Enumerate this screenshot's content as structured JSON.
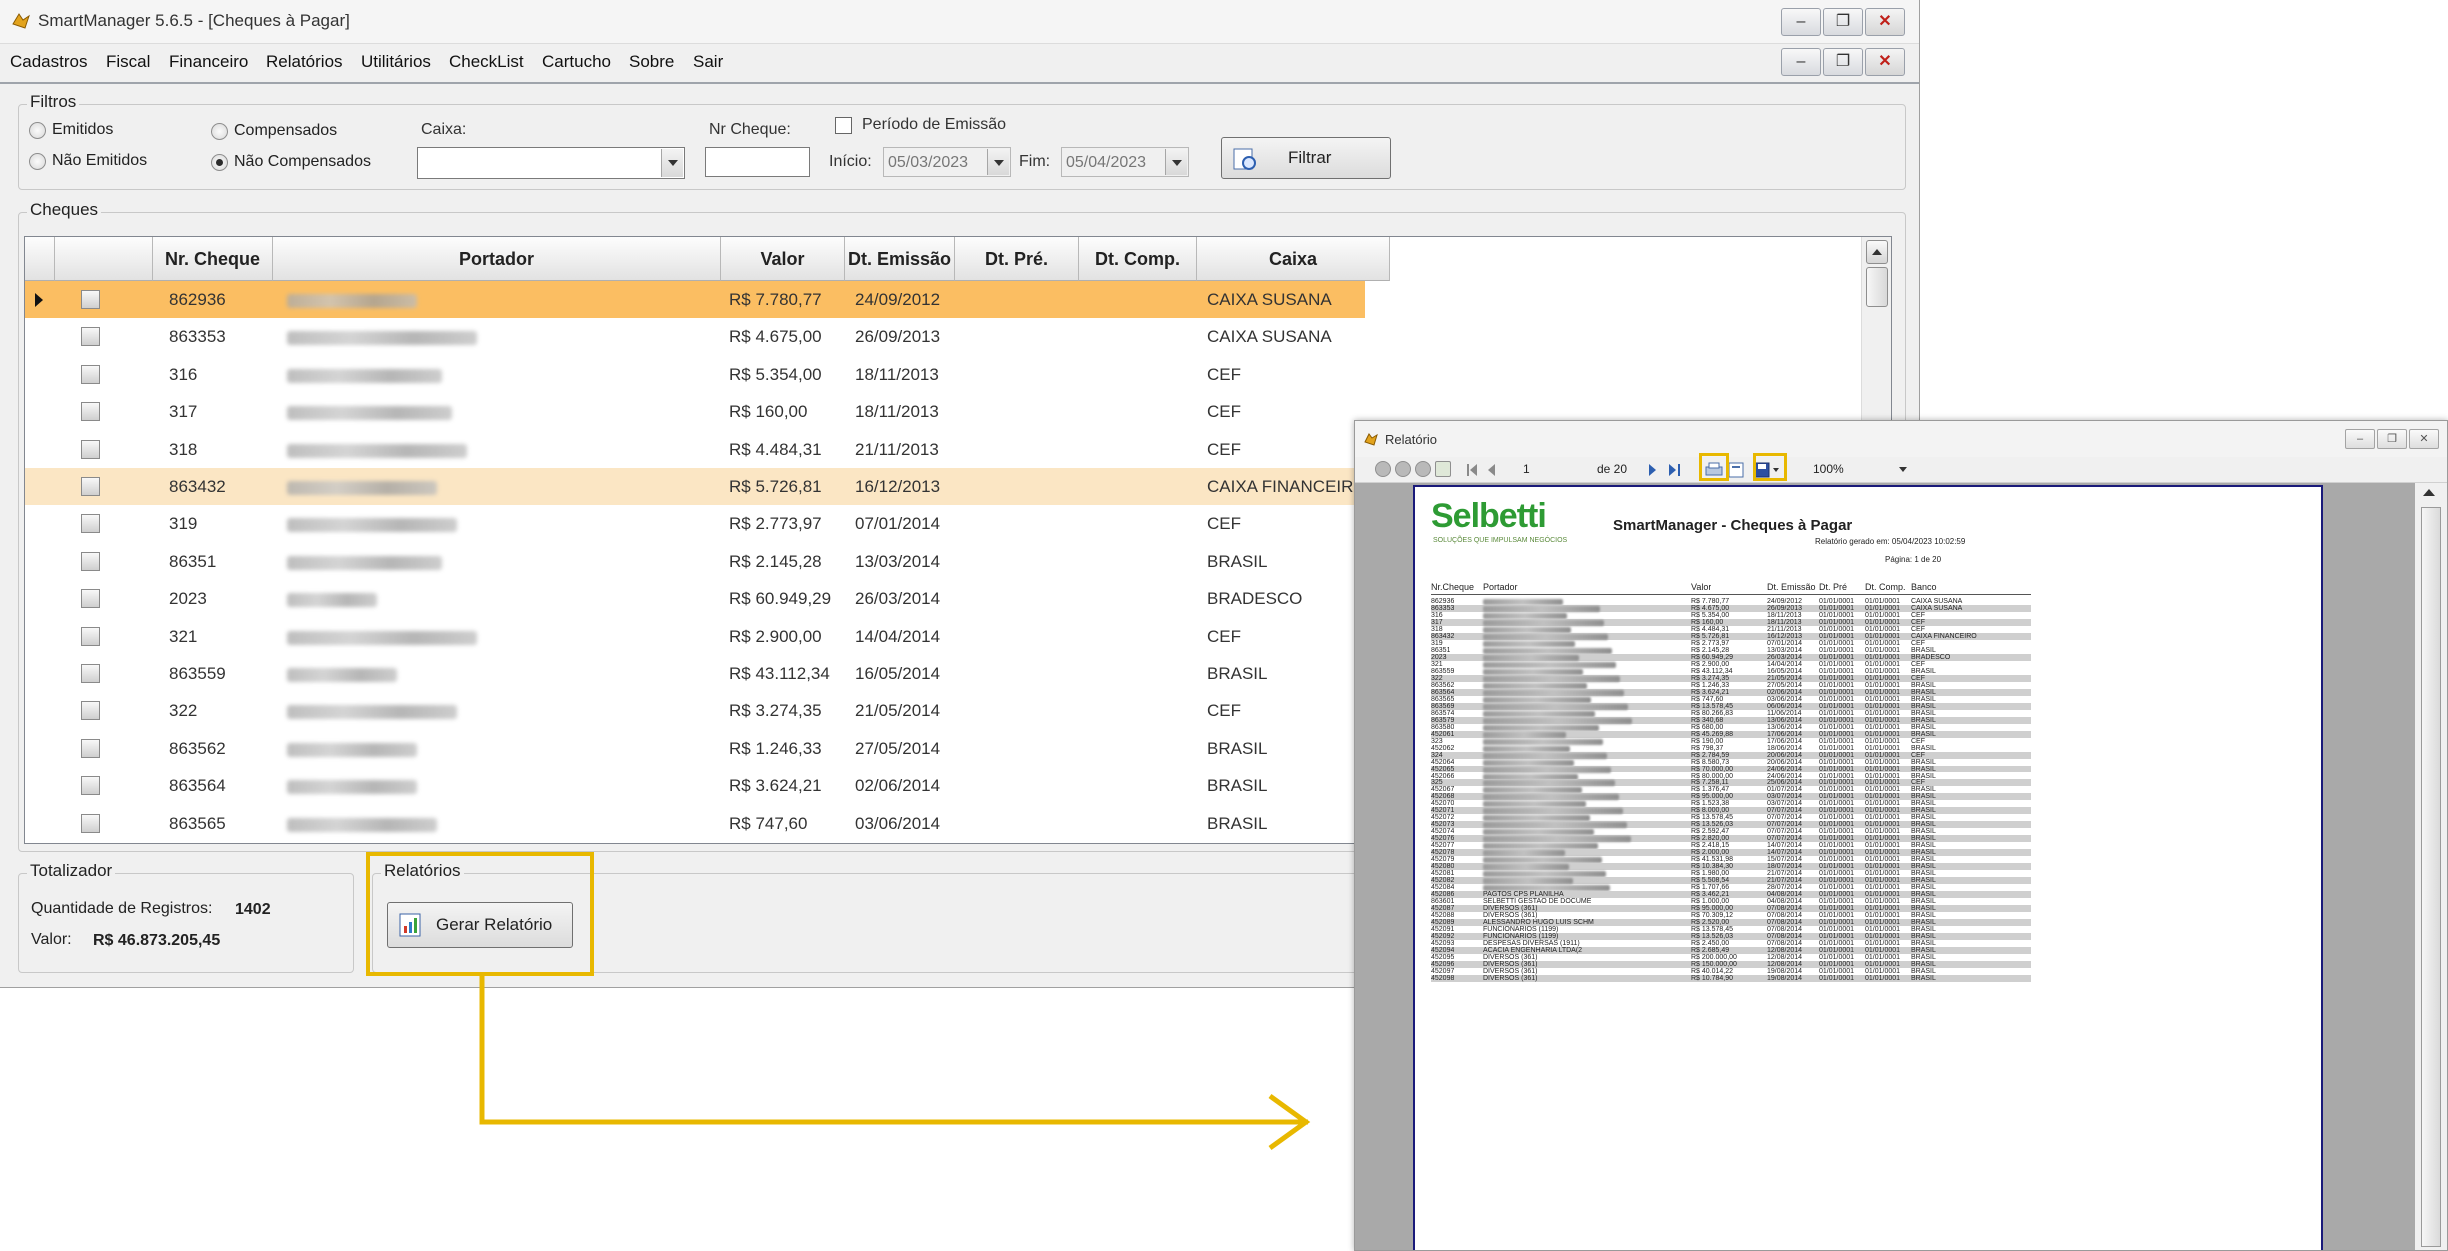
{
  "main_window": {
    "title": "SmartManager 5.6.5 - [Cheques à Pagar]",
    "window_buttons": {
      "minimize": "–",
      "restore": "❐",
      "close": "✕"
    },
    "menu": [
      "Cadastros",
      "Fiscal",
      "Financeiro",
      "Relatórios",
      "Utilitários",
      "CheckList",
      "Cartucho",
      "Sobre",
      "Sair"
    ]
  },
  "filters": {
    "legend": "Filtros",
    "radio_emitidos": "Emitidos",
    "radio_nao_emitidos": "Não Emitidos",
    "radio_compensados": "Compensados",
    "radio_nao_compensados": "Não Compensados",
    "selected_radio": "Não Compensados",
    "caixa_label": "Caixa:",
    "caixa_value": "",
    "nr_cheque_label": "Nr Cheque:",
    "nr_cheque_value": "",
    "periodo_label": "Período de Emissão",
    "periodo_checked": false,
    "inicio_label": "Início:",
    "inicio_value": "05/03/2023",
    "fim_label": "Fim:",
    "fim_value": "05/04/2023",
    "filtrar_button": "Filtrar"
  },
  "cheques": {
    "legend": "Cheques",
    "columns": [
      "Nr. Cheque",
      "Portador",
      "Valor",
      "Dt. Emissão",
      "Dt. Pré.",
      "Dt. Comp.",
      "Caixa"
    ],
    "rows": [
      {
        "nr": "862936",
        "valor": "R$ 7.780,77",
        "emissao": "24/09/2012",
        "caixa": "CAIXA SUSANA",
        "state": "selected"
      },
      {
        "nr": "863353",
        "valor": "R$ 4.675,00",
        "emissao": "26/09/2013",
        "caixa": "CAIXA SUSANA",
        "state": ""
      },
      {
        "nr": "316",
        "valor": "R$ 5.354,00",
        "emissao": "18/11/2013",
        "caixa": "CEF",
        "state": ""
      },
      {
        "nr": "317",
        "valor": "R$ 160,00",
        "emissao": "18/11/2013",
        "caixa": "CEF",
        "state": ""
      },
      {
        "nr": "318",
        "valor": "R$ 4.484,31",
        "emissao": "21/11/2013",
        "caixa": "CEF",
        "state": ""
      },
      {
        "nr": "863432",
        "valor": "R$ 5.726,81",
        "emissao": "16/12/2013",
        "caixa": "CAIXA FINANCEIRO",
        "state": "alt"
      },
      {
        "nr": "319",
        "valor": "R$ 2.773,97",
        "emissao": "07/01/2014",
        "caixa": "CEF",
        "state": ""
      },
      {
        "nr": "86351",
        "valor": "R$ 2.145,28",
        "emissao": "13/03/2014",
        "caixa": "BRASIL",
        "state": ""
      },
      {
        "nr": "2023",
        "valor": "R$ 60.949,29",
        "emissao": "26/03/2014",
        "caixa": "BRADESCO",
        "state": ""
      },
      {
        "nr": "321",
        "valor": "R$ 2.900,00",
        "emissao": "14/04/2014",
        "caixa": "CEF",
        "state": ""
      },
      {
        "nr": "863559",
        "valor": "R$ 43.112,34",
        "emissao": "16/05/2014",
        "caixa": "BRASIL",
        "state": ""
      },
      {
        "nr": "322",
        "valor": "R$ 3.274,35",
        "emissao": "21/05/2014",
        "caixa": "CEF",
        "state": ""
      },
      {
        "nr": "863562",
        "valor": "R$ 1.246,33",
        "emissao": "27/05/2014",
        "caixa": "BRASIL",
        "state": ""
      },
      {
        "nr": "863564",
        "valor": "R$ 3.624,21",
        "emissao": "02/06/2014",
        "caixa": "BRASIL",
        "state": ""
      },
      {
        "nr": "863565",
        "valor": "R$ 747,60",
        "emissao": "03/06/2014",
        "caixa": "BRASIL",
        "state": ""
      }
    ]
  },
  "totalizador": {
    "legend": "Totalizador",
    "quantidade_label": "Quantidade de Registros:",
    "quantidade_value": "1402",
    "valor_label": "Valor:",
    "valor_value": "R$ 46.873.205,45"
  },
  "relatorios": {
    "legend": "Relatórios",
    "gerar_button": "Gerar Relatório"
  },
  "highlight_color": "#e8b800",
  "report_window": {
    "title": "Relatório",
    "toolbar": {
      "page": "1",
      "of_pages": "de 20",
      "zoom": "100%"
    },
    "logo": "Selbetti",
    "logo_tagline": "SOLUÇÕES QUE IMPULSAM NEGÓCIOS",
    "report_title": "SmartManager - Cheques à Pagar",
    "generated": "Relatório gerado em: 05/04/2023 10:02:59",
    "page_label": "Página: 1 de 20",
    "columns": [
      "Nr.Cheque",
      "Portador",
      "Valor",
      "Dt. Emissão",
      "Dt. Pré",
      "Dt. Comp.",
      "Banco"
    ],
    "rows": [
      {
        "nr": "862936",
        "portador": "",
        "valor": "R$ 7.780,77",
        "emissao": "24/09/2012",
        "pre": "01/01/0001",
        "comp": "01/01/0001",
        "banco": "CAIXA SUSANA"
      },
      {
        "nr": "863353",
        "portador": "",
        "valor": "R$ 4.675,00",
        "emissao": "26/09/2013",
        "pre": "01/01/0001",
        "comp": "01/01/0001",
        "banco": "CAIXA SUSANA"
      },
      {
        "nr": "316",
        "portador": "",
        "valor": "R$ 5.354,00",
        "emissao": "18/11/2013",
        "pre": "01/01/0001",
        "comp": "01/01/0001",
        "banco": "CEF"
      },
      {
        "nr": "317",
        "portador": "",
        "valor": "R$ 160,00",
        "emissao": "18/11/2013",
        "pre": "01/01/0001",
        "comp": "01/01/0001",
        "banco": "CEF"
      },
      {
        "nr": "318",
        "portador": "",
        "valor": "R$ 4.484,31",
        "emissao": "21/11/2013",
        "pre": "01/01/0001",
        "comp": "01/01/0001",
        "banco": "CEF"
      },
      {
        "nr": "863432",
        "portador": "",
        "valor": "R$ 5.726,81",
        "emissao": "16/12/2013",
        "pre": "01/01/0001",
        "comp": "01/01/0001",
        "banco": "CAIXA FINANCEIRO"
      },
      {
        "nr": "319",
        "portador": "",
        "valor": "R$ 2.773,97",
        "emissao": "07/01/2014",
        "pre": "01/01/0001",
        "comp": "01/01/0001",
        "banco": "CEF"
      },
      {
        "nr": "86351",
        "portador": "",
        "valor": "R$ 2.145,28",
        "emissao": "13/03/2014",
        "pre": "01/01/0001",
        "comp": "01/01/0001",
        "banco": "BRASIL"
      },
      {
        "nr": "2023",
        "portador": "",
        "valor": "R$ 60.949,29",
        "emissao": "26/03/2014",
        "pre": "01/01/0001",
        "comp": "01/01/0001",
        "banco": "BRADESCO"
      },
      {
        "nr": "321",
        "portador": "",
        "valor": "R$ 2.900,00",
        "emissao": "14/04/2014",
        "pre": "01/01/0001",
        "comp": "01/01/0001",
        "banco": "CEF"
      },
      {
        "nr": "863559",
        "portador": "",
        "valor": "R$ 43.112,34",
        "emissao": "16/05/2014",
        "pre": "01/01/0001",
        "comp": "01/01/0001",
        "banco": "BRASIL"
      },
      {
        "nr": "322",
        "portador": "",
        "valor": "R$ 3.274,35",
        "emissao": "21/05/2014",
        "pre": "01/01/0001",
        "comp": "01/01/0001",
        "banco": "CEF"
      },
      {
        "nr": "863562",
        "portador": "",
        "valor": "R$ 1.246,33",
        "emissao": "27/05/2014",
        "pre": "01/01/0001",
        "comp": "01/01/0001",
        "banco": "BRASIL"
      },
      {
        "nr": "863564",
        "portador": "",
        "valor": "R$ 3.624,21",
        "emissao": "02/06/2014",
        "pre": "01/01/0001",
        "comp": "01/01/0001",
        "banco": "BRASIL"
      },
      {
        "nr": "863565",
        "portador": "",
        "valor": "R$ 747,60",
        "emissao": "03/06/2014",
        "pre": "01/01/0001",
        "comp": "01/01/0001",
        "banco": "BRASIL"
      },
      {
        "nr": "863569",
        "portador": "",
        "valor": "R$ 13.578,45",
        "emissao": "06/06/2014",
        "pre": "01/01/0001",
        "comp": "01/01/0001",
        "banco": "BRASIL"
      },
      {
        "nr": "863574",
        "portador": "",
        "valor": "R$ 80.266,83",
        "emissao": "11/06/2014",
        "pre": "01/01/0001",
        "comp": "01/01/0001",
        "banco": "BRASIL"
      },
      {
        "nr": "863579",
        "portador": "",
        "valor": "R$ 340,68",
        "emissao": "13/06/2014",
        "pre": "01/01/0001",
        "comp": "01/01/0001",
        "banco": "BRASIL"
      },
      {
        "nr": "863580",
        "portador": "",
        "valor": "R$ 680,00",
        "emissao": "13/06/2014",
        "pre": "01/01/0001",
        "comp": "01/01/0001",
        "banco": "BRASIL"
      },
      {
        "nr": "452061",
        "portador": "",
        "valor": "R$ 45.269,88",
        "emissao": "17/06/2014",
        "pre": "01/01/0001",
        "comp": "01/01/0001",
        "banco": "BRASIL"
      },
      {
        "nr": "323",
        "portador": "",
        "valor": "R$ 190,00",
        "emissao": "17/06/2014",
        "pre": "01/01/0001",
        "comp": "01/01/0001",
        "banco": "CEF"
      },
      {
        "nr": "452062",
        "portador": "",
        "valor": "R$ 798,37",
        "emissao": "18/06/2014",
        "pre": "01/01/0001",
        "comp": "01/01/0001",
        "banco": "BRASIL"
      },
      {
        "nr": "324",
        "portador": "",
        "valor": "R$ 2.784,59",
        "emissao": "20/06/2014",
        "pre": "01/01/0001",
        "comp": "01/01/0001",
        "banco": "CEF"
      },
      {
        "nr": "452064",
        "portador": "",
        "valor": "R$ 8.580,73",
        "emissao": "20/06/2014",
        "pre": "01/01/0001",
        "comp": "01/01/0001",
        "banco": "BRASIL"
      },
      {
        "nr": "452065",
        "portador": "",
        "valor": "R$ 70.000,00",
        "emissao": "24/06/2014",
        "pre": "01/01/0001",
        "comp": "01/01/0001",
        "banco": "BRASIL"
      },
      {
        "nr": "452066",
        "portador": "",
        "valor": "R$ 80.000,00",
        "emissao": "24/06/2014",
        "pre": "01/01/0001",
        "comp": "01/01/0001",
        "banco": "BRASIL"
      },
      {
        "nr": "325",
        "portador": "",
        "valor": "R$ 7.258,11",
        "emissao": "25/06/2014",
        "pre": "01/01/0001",
        "comp": "01/01/0001",
        "banco": "CEF"
      },
      {
        "nr": "452067",
        "portador": "",
        "valor": "R$ 1.376,47",
        "emissao": "01/07/2014",
        "pre": "01/01/0001",
        "comp": "01/01/0001",
        "banco": "BRASIL"
      },
      {
        "nr": "452068",
        "portador": "",
        "valor": "R$ 95.000,00",
        "emissao": "03/07/2014",
        "pre": "01/01/0001",
        "comp": "01/01/0001",
        "banco": "BRASIL"
      },
      {
        "nr": "452070",
        "portador": "",
        "valor": "R$ 1.523,38",
        "emissao": "03/07/2014",
        "pre": "01/01/0001",
        "comp": "01/01/0001",
        "banco": "BRASIL"
      },
      {
        "nr": "452071",
        "portador": "",
        "valor": "R$ 8.000,00",
        "emissao": "07/07/2014",
        "pre": "01/01/0001",
        "comp": "01/01/0001",
        "banco": "BRASIL"
      },
      {
        "nr": "452072",
        "portador": "",
        "valor": "R$ 13.578,45",
        "emissao": "07/07/2014",
        "pre": "01/01/0001",
        "comp": "01/01/0001",
        "banco": "BRASIL"
      },
      {
        "nr": "452073",
        "portador": "",
        "valor": "R$ 13.526,03",
        "emissao": "07/07/2014",
        "pre": "01/01/0001",
        "comp": "01/01/0001",
        "banco": "BRASIL"
      },
      {
        "nr": "452074",
        "portador": "",
        "valor": "R$ 2.592,47",
        "emissao": "07/07/2014",
        "pre": "01/01/0001",
        "comp": "01/01/0001",
        "banco": "BRASIL"
      },
      {
        "nr": "452076",
        "portador": "",
        "valor": "R$ 2.820,00",
        "emissao": "07/07/2014",
        "pre": "01/01/0001",
        "comp": "01/01/0001",
        "banco": "BRASIL"
      },
      {
        "nr": "452077",
        "portador": "",
        "valor": "R$ 2.418,15",
        "emissao": "14/07/2014",
        "pre": "01/01/0001",
        "comp": "01/01/0001",
        "banco": "BRASIL"
      },
      {
        "nr": "452078",
        "portador": "",
        "valor": "R$ 2.000,00",
        "emissao": "14/07/2014",
        "pre": "01/01/0001",
        "comp": "01/01/0001",
        "banco": "BRASIL"
      },
      {
        "nr": "452079",
        "portador": "",
        "valor": "R$ 41.531,98",
        "emissao": "15/07/2014",
        "pre": "01/01/0001",
        "comp": "01/01/0001",
        "banco": "BRASIL"
      },
      {
        "nr": "452080",
        "portador": "",
        "valor": "R$ 10.384,30",
        "emissao": "18/07/2014",
        "pre": "01/01/0001",
        "comp": "01/01/0001",
        "banco": "BRASIL"
      },
      {
        "nr": "452081",
        "portador": "",
        "valor": "R$ 1.980,00",
        "emissao": "21/07/2014",
        "pre": "01/01/0001",
        "comp": "01/01/0001",
        "banco": "BRASIL"
      },
      {
        "nr": "452082",
        "portador": "",
        "valor": "R$ 5.508,54",
        "emissao": "21/07/2014",
        "pre": "01/01/0001",
        "comp": "01/01/0001",
        "banco": "BRASIL"
      },
      {
        "nr": "452084",
        "portador": "",
        "valor": "R$ 1.707,66",
        "emissao": "28/07/2014",
        "pre": "01/01/0001",
        "comp": "01/01/0001",
        "banco": "BRASIL"
      },
      {
        "nr": "452086",
        "portador": "PAGTOS CPS PLANILHA",
        "valor": "R$ 3.462,21",
        "emissao": "04/08/2014",
        "pre": "01/01/0001",
        "comp": "01/01/0001",
        "banco": "BRASIL"
      },
      {
        "nr": "863601",
        "portador": "SELBETTI GESTAO DE DOCUME",
        "valor": "R$ 1.000,00",
        "emissao": "04/08/2014",
        "pre": "01/01/0001",
        "comp": "01/01/0001",
        "banco": "BRASIL"
      },
      {
        "nr": "452087",
        "portador": "DIVERSOS (361)",
        "valor": "R$ 95.000,00",
        "emissao": "07/08/2014",
        "pre": "01/01/0001",
        "comp": "01/01/0001",
        "banco": "BRASIL"
      },
      {
        "nr": "452088",
        "portador": "DIVERSOS (361)",
        "valor": "R$ 70.309,12",
        "emissao": "07/08/2014",
        "pre": "01/01/0001",
        "comp": "01/01/0001",
        "banco": "BRASIL"
      },
      {
        "nr": "452089",
        "portador": "ALESSANDRO HUGO LUIS SCHM",
        "valor": "R$ 2.520,00",
        "emissao": "07/08/2014",
        "pre": "01/01/0001",
        "comp": "01/01/0001",
        "banco": "BRASIL"
      },
      {
        "nr": "452091",
        "portador": "FUNCIONARIOS (1199)",
        "valor": "R$ 13.578,45",
        "emissao": "07/08/2014",
        "pre": "01/01/0001",
        "comp": "01/01/0001",
        "banco": "BRASIL"
      },
      {
        "nr": "452092",
        "portador": "FUNCIONARIOS (1199)",
        "valor": "R$ 13.526,03",
        "emissao": "07/08/2014",
        "pre": "01/01/0001",
        "comp": "01/01/0001",
        "banco": "BRASIL"
      },
      {
        "nr": "452093",
        "portador": "DESPESAS DIVERSAS (1911)",
        "valor": "R$ 2.450,00",
        "emissao": "07/08/2014",
        "pre": "01/01/0001",
        "comp": "01/01/0001",
        "banco": "BRASIL"
      },
      {
        "nr": "452094",
        "portador": "ACACIA ENGENHARIA LTDA(2",
        "valor": "R$ 2.685,49",
        "emissao": "12/08/2014",
        "pre": "01/01/0001",
        "comp": "01/01/0001",
        "banco": "BRASIL"
      },
      {
        "nr": "452095",
        "portador": "DIVERSOS (361)",
        "valor": "R$ 200.000,00",
        "emissao": "12/08/2014",
        "pre": "01/01/0001",
        "comp": "01/01/0001",
        "banco": "BRASIL"
      },
      {
        "nr": "452096",
        "portador": "DIVERSOS (361)",
        "valor": "R$ 150.000,00",
        "emissao": "12/08/2014",
        "pre": "01/01/0001",
        "comp": "01/01/0001",
        "banco": "BRASIL"
      },
      {
        "nr": "452097",
        "portador": "DIVERSOS (361)",
        "valor": "R$ 40.014,22",
        "emissao": "19/08/2014",
        "pre": "01/01/0001",
        "comp": "01/01/0001",
        "banco": "BRASIL"
      },
      {
        "nr": "452098",
        "portador": "DIVERSOS (361)",
        "valor": "R$ 10.784,90",
        "emissao": "19/08/2014",
        "pre": "01/01/0001",
        "comp": "01/01/0001",
        "banco": "BRASIL"
      }
    ]
  }
}
